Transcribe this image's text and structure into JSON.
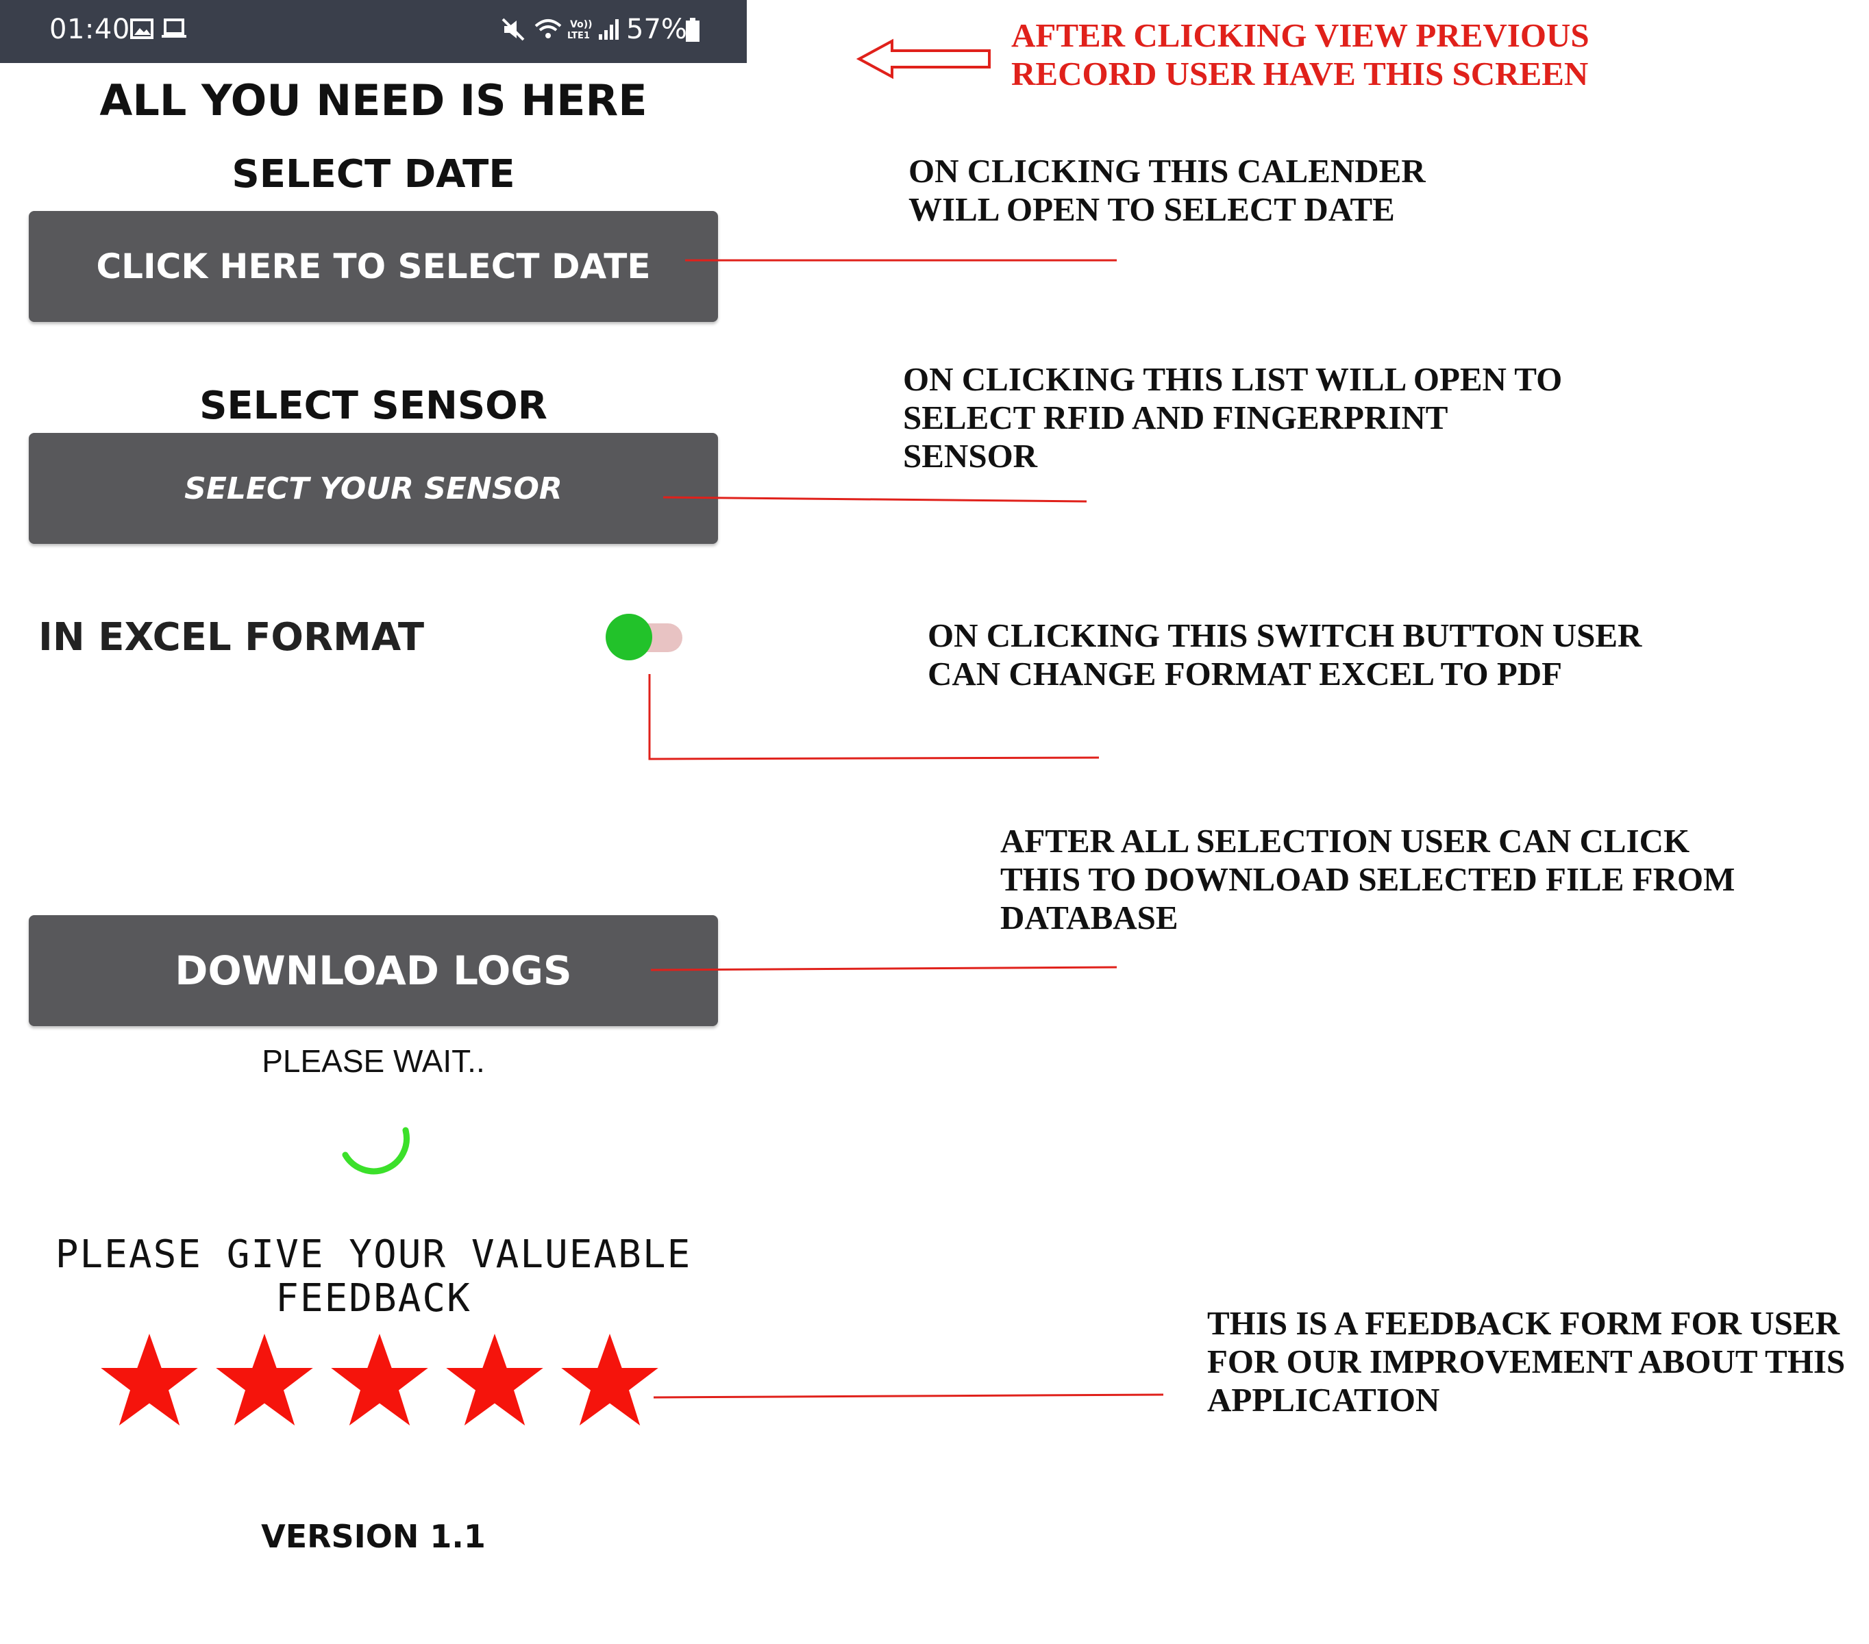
{
  "status_bar": {
    "time": "01:40",
    "battery": "57%",
    "icons": [
      "gallery-icon",
      "laptop-icon",
      "mute-icon",
      "wifi-icon",
      "volte-icon",
      "signal-icon",
      "battery-icon"
    ]
  },
  "app": {
    "title": "ALL YOU NEED IS HERE",
    "date_section_label": "SELECT DATE",
    "date_button_label": "CLICK HERE TO SELECT DATE",
    "sensor_section_label": "SELECT SENSOR",
    "sensor_button_label": "SELECT YOUR SENSOR",
    "format_label": "IN EXCEL FORMAT",
    "format_switch_on": true,
    "download_button_label": "DOWNLOAD LOGS",
    "loading_text": "PLEASE WAIT..",
    "feedback_prompt": "PLEASE GIVE YOUR VALUEABLE\nFEEDBACK",
    "rating": {
      "value": 5,
      "max": 5
    },
    "version": "VERSION 1.1"
  },
  "annotations": {
    "top": "AFTER CLICKING VIEW PREVIOUS\nRECORD USER HAVE THIS SCREEN",
    "calendar": "ON CLICKING THIS CALENDER\nWILL OPEN TO SELECT DATE",
    "sensor": "ON CLICKING THIS LIST WILL OPEN TO\nSELECT  RFID AND FINGERPRINT\nSENSOR",
    "switch": "ON CLICKING THIS SWITCH BUTTON USER\nCAN CHANGE FORMAT EXCEL TO PDF",
    "download": "AFTER ALL SELECTION USER CAN CLICK\nTHIS TO DOWNLOAD SELECTED FILE FROM\nDATABASE",
    "feedback": "THIS IS A FEEDBACK FORM FOR USER\nFOR OUR IMPROVEMENT ABOUT THIS\nAPPLICATION"
  },
  "colors": {
    "status_bar": "#3a3f4b",
    "button": "#58585b",
    "switch_thumb": "#22c22a",
    "switch_track": "#e8c3c3",
    "spinner": "#3be02a",
    "star": "#f5140c",
    "annotation_red": "#e0211b"
  }
}
